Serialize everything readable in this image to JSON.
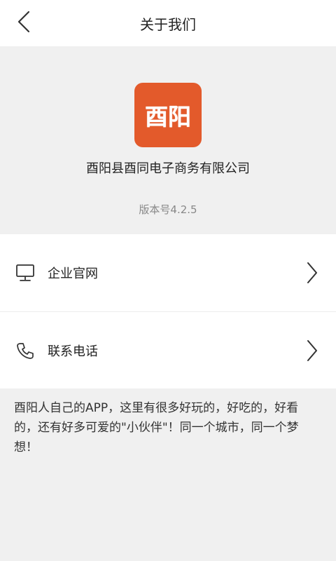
{
  "header": {
    "title": "关于我们",
    "back_icon": "chevron-left-icon"
  },
  "about": {
    "logo_text": "酉阳",
    "logo_color": "#e35a2b",
    "company_name": "酉阳县酉同电子商务有限公司",
    "version": "版本号4.2.5"
  },
  "links": [
    {
      "icon": "monitor-icon",
      "label": "企业官网"
    },
    {
      "icon": "phone-icon",
      "label": "联系电话"
    }
  ],
  "description": "酉阳人自己的APP，这里有很多好玩的，好吃的，好看的，还有好多可爱的\"小伙伴\"！同一个城市，同一个梦想！"
}
